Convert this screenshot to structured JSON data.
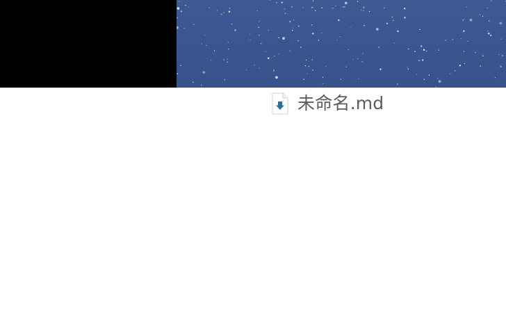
{
  "desktop": {
    "background_color": "#ffffff",
    "left_panel_color": "#000000",
    "wallpaper": {
      "name": "starry-night-wallpaper",
      "base_color": "#3b5891",
      "star_color": "#ffffff"
    }
  },
  "file": {
    "name": "未命名.md",
    "icon": "markdown-file-icon",
    "icon_arrow_color": "#2e6f9a"
  }
}
